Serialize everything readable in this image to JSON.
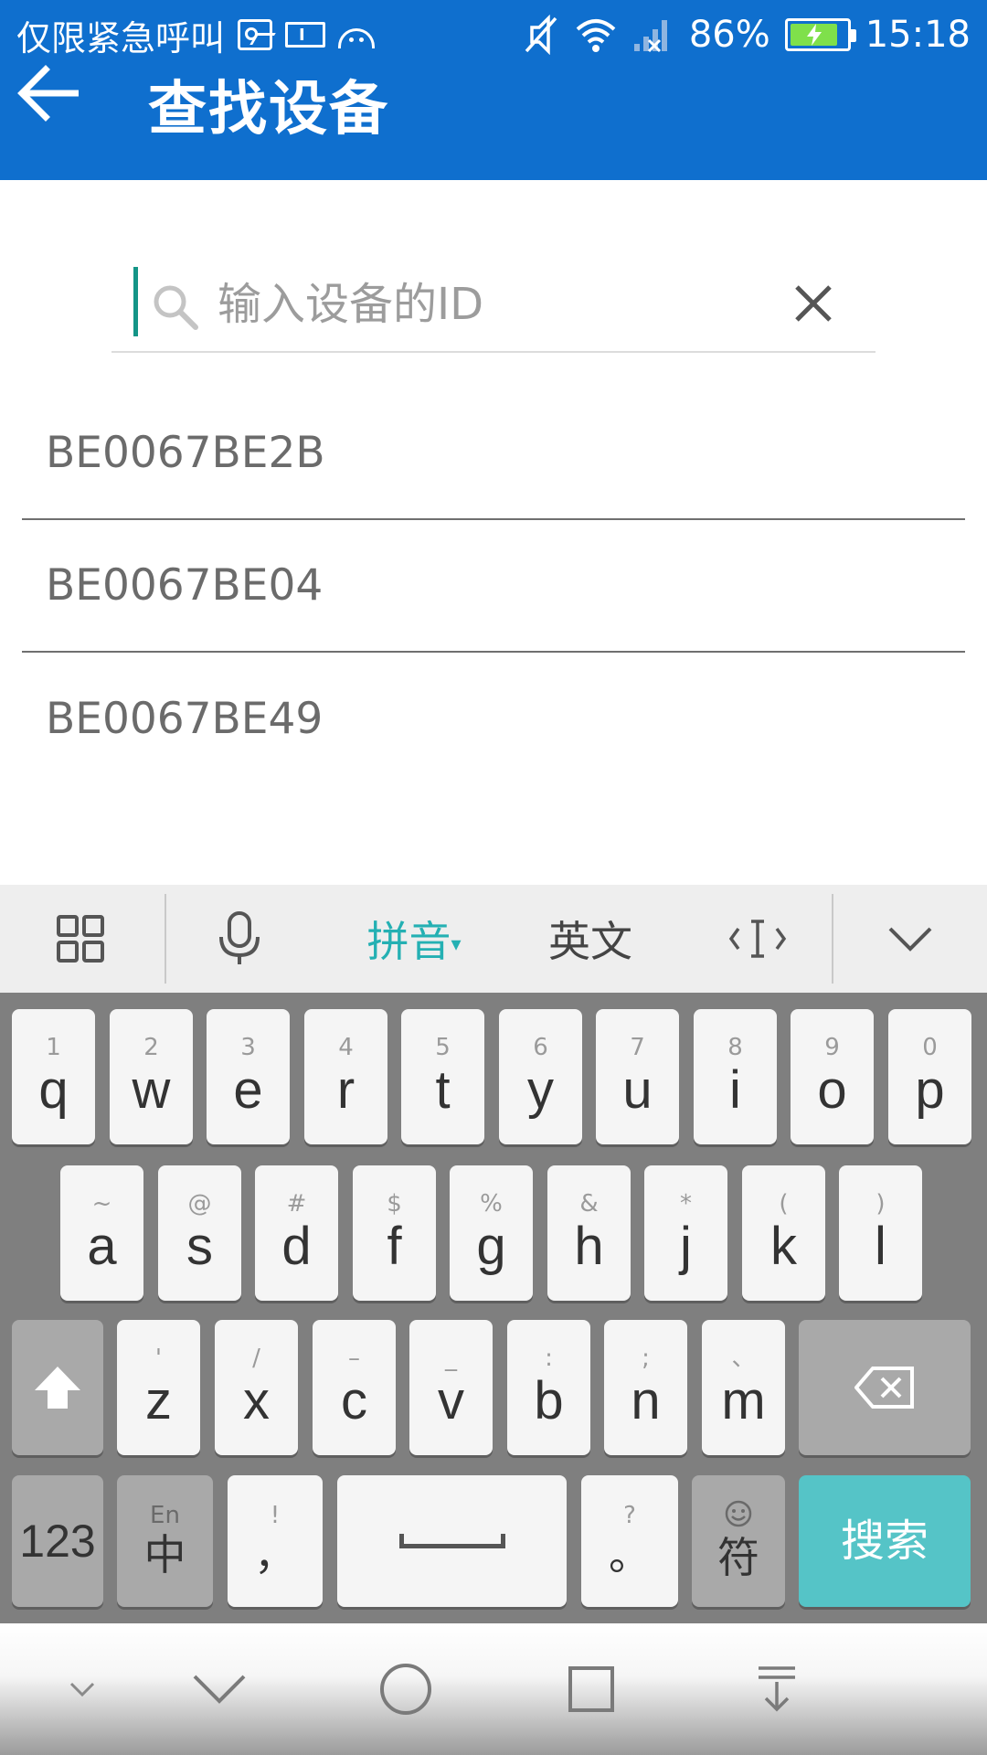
{
  "status_bar": {
    "carrier": "仅限紧急呼叫",
    "battery_percent": "86%",
    "time": "15:18",
    "battery_level": 0.86,
    "icons": [
      "image-icon",
      "tv-icon",
      "android-icon",
      "mute-icon",
      "wifi-icon",
      "signal-icon",
      "battery-icon"
    ]
  },
  "app_bar": {
    "title": "查找设备",
    "back_icon": "arrow-left-icon"
  },
  "search": {
    "value": "",
    "placeholder": "输入设备的ID",
    "search_icon": "search-icon",
    "clear_icon": "close-icon"
  },
  "results": [
    {
      "id": "BE0067BE2B"
    },
    {
      "id": "BE0067BE04"
    },
    {
      "id": "BE0067BE49"
    }
  ],
  "ime_toolbar": {
    "pinyin": "拼音",
    "english": "英文",
    "icons": [
      "grid-icon",
      "microphone-icon",
      "cursor-move-icon",
      "chevron-down-icon"
    ]
  },
  "keyboard": {
    "row1": [
      {
        "main": "q",
        "hint": "1"
      },
      {
        "main": "w",
        "hint": "2"
      },
      {
        "main": "e",
        "hint": "3"
      },
      {
        "main": "r",
        "hint": "4"
      },
      {
        "main": "t",
        "hint": "5"
      },
      {
        "main": "y",
        "hint": "6"
      },
      {
        "main": "u",
        "hint": "7"
      },
      {
        "main": "i",
        "hint": "8"
      },
      {
        "main": "o",
        "hint": "9"
      },
      {
        "main": "p",
        "hint": "0"
      }
    ],
    "row2": [
      {
        "main": "a",
        "hint": "~"
      },
      {
        "main": "s",
        "hint": "@"
      },
      {
        "main": "d",
        "hint": "#"
      },
      {
        "main": "f",
        "hint": "$"
      },
      {
        "main": "g",
        "hint": "%"
      },
      {
        "main": "h",
        "hint": "&"
      },
      {
        "main": "j",
        "hint": "*"
      },
      {
        "main": "k",
        "hint": "("
      },
      {
        "main": "l",
        "hint": ")"
      }
    ],
    "row3": [
      {
        "main": "z",
        "hint": "'"
      },
      {
        "main": "x",
        "hint": "/"
      },
      {
        "main": "c",
        "hint": "–"
      },
      {
        "main": "v",
        "hint": "_"
      },
      {
        "main": "b",
        "hint": ":"
      },
      {
        "main": "n",
        "hint": ";"
      },
      {
        "main": "m",
        "hint": "、"
      }
    ],
    "num_label": "123",
    "lang_hint": "En",
    "lang_main": "中",
    "comma_hint": "!",
    "comma_main": "，",
    "period_hint": "?",
    "period_main": "。",
    "symbol_label": "符",
    "search_label": "搜索",
    "shift_icon": "shift-arrow-icon",
    "backspace_icon": "backspace-icon",
    "space_icon": "space-bar-icon",
    "emoji_icon": "smiley-icon"
  },
  "nav_bar": {
    "icons": [
      "hide-keyboard-icon",
      "back-chevron-icon",
      "home-circle-icon",
      "recents-square-icon",
      "notification-pull-icon"
    ]
  }
}
